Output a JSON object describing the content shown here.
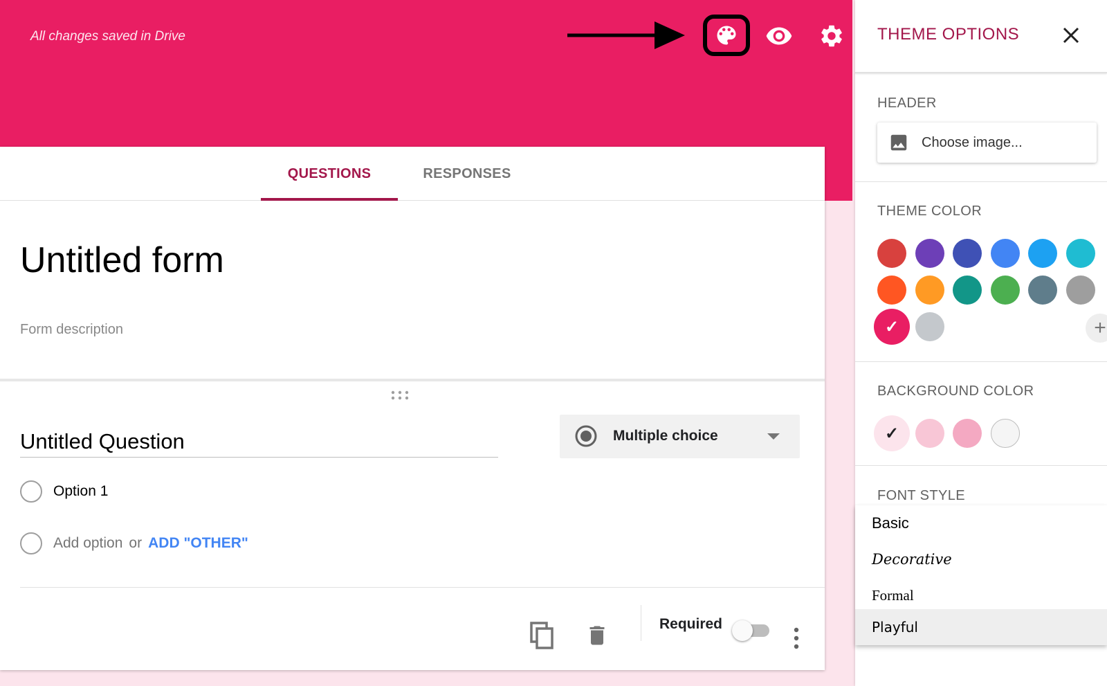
{
  "header": {
    "save_status": "All changes saved in Drive",
    "accent_color": "#e91e63",
    "icons": [
      "palette-icon",
      "eye-icon",
      "gear-icon"
    ]
  },
  "tabs": [
    {
      "label": "QUESTIONS",
      "active": true
    },
    {
      "label": "RESPONSES",
      "active": false
    }
  ],
  "form": {
    "title": "Untitled form",
    "description_placeholder": "Form description"
  },
  "question": {
    "title": "Untitled Question",
    "type": "Multiple choice",
    "options": [
      "Option 1"
    ],
    "add_option": "Add option",
    "or_text": "or",
    "add_other": "ADD \"OTHER\"",
    "required_label": "Required",
    "required": false
  },
  "panel": {
    "title": "THEME OPTIONS",
    "header_label": "HEADER",
    "choose_image": "Choose image...",
    "theme_color_label": "THEME COLOR",
    "theme_colors": [
      "#d8413e",
      "#6d3fb7",
      "#3f51b5",
      "#4285f4",
      "#1da1f2",
      "#1fbcd2",
      "#ff5622",
      "#ff9a24",
      "#129688",
      "#4caf50",
      "#5f7d8b",
      "#9e9e9e",
      "#e91e63",
      "#c4c8cc"
    ],
    "selected_theme_color": "#e91e63",
    "background_color_label": "BACKGROUND COLOR",
    "background_colors": [
      "#fce4ec",
      "#f8c6d6",
      "#f4a9c2",
      "#f5f5f5"
    ],
    "selected_background_color": "#fce4ec",
    "font_style_label": "FONT STYLE",
    "font_styles": [
      "Basic",
      "Decorative",
      "Formal",
      "Playful"
    ],
    "selected_font_style": "Playful"
  }
}
